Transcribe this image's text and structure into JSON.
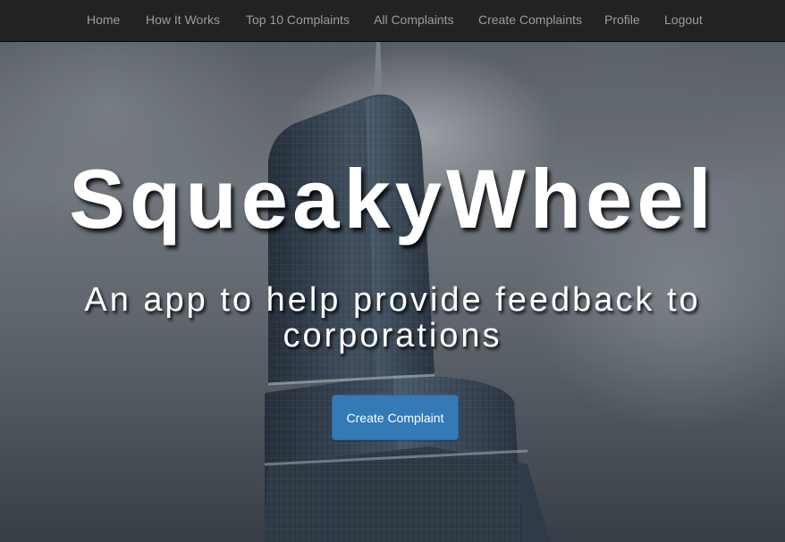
{
  "navbar": {
    "links": [
      {
        "label": "Home"
      },
      {
        "label": "How It Works"
      },
      {
        "label": "Top 10 Complaints"
      },
      {
        "label": "All Complaints"
      },
      {
        "label": "Create Complaints"
      },
      {
        "label": "Profile"
      },
      {
        "label": "Logout"
      }
    ]
  },
  "hero": {
    "title": "SqueakyWheel",
    "tagline": "An app to help provide feedback to corporations",
    "cta_label": "Create Complaint"
  },
  "colors": {
    "navbar_bg": "#222222",
    "nav_link": "#9d9d9d",
    "cta_bg": "#337ab7",
    "text": "#ffffff"
  }
}
